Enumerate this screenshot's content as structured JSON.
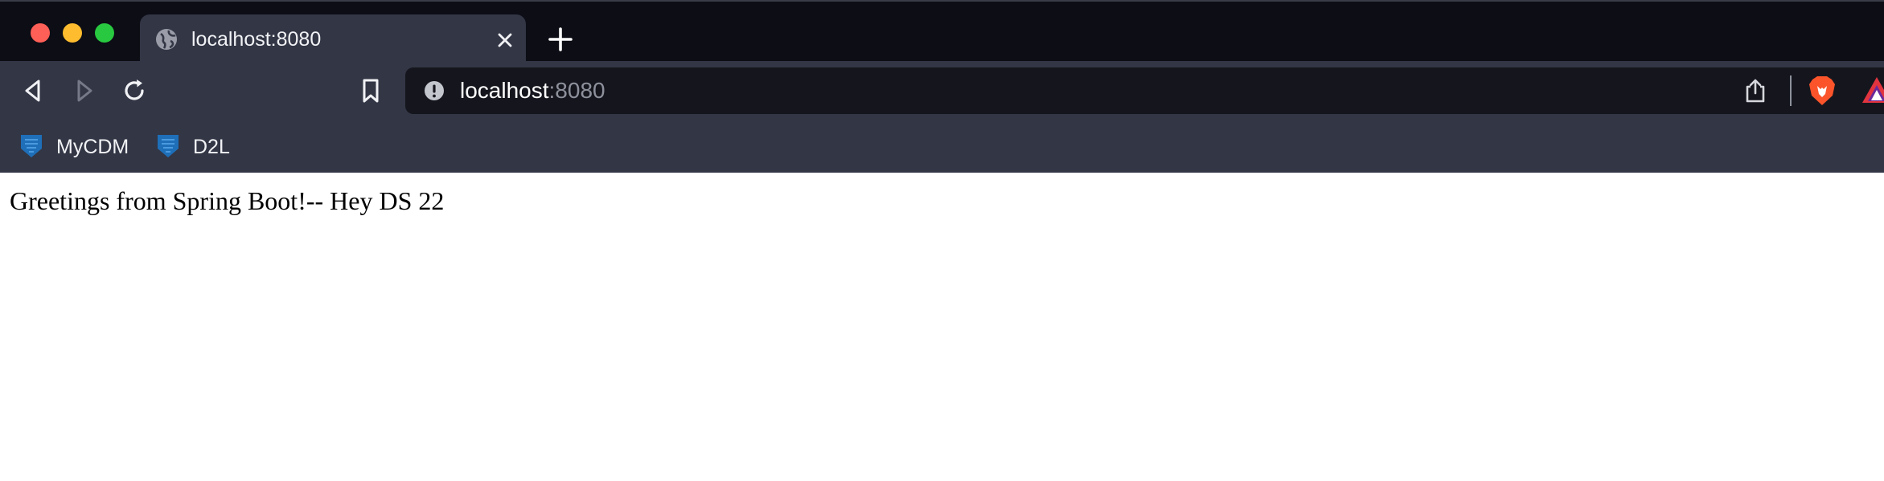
{
  "window": {
    "traffic_lights": [
      "close",
      "minimize",
      "zoom"
    ]
  },
  "tab": {
    "title": "localhost:8080",
    "icon": "globe-icon",
    "close_icon": "close-icon"
  },
  "toolbar": {
    "back_icon": "back-icon",
    "forward_icon": "forward-icon",
    "reload_icon": "reload-icon",
    "bookmark_icon": "bookmark-icon"
  },
  "address_bar": {
    "host": "localhost",
    "port": ":8080",
    "site_info_icon": "info-icon",
    "share_icon": "share-icon",
    "brave_shields_icon": "brave-lion-icon",
    "rewards_icon": "brave-rewards-icon"
  },
  "bookmarks": [
    {
      "label": "MyCDM",
      "icon": "shield-bookmark-icon"
    },
    {
      "label": "D2L",
      "icon": "shield-bookmark-icon"
    }
  ],
  "page": {
    "text": "Greetings from Spring Boot!-- Hey DS 22"
  },
  "colors": {
    "titlebar": "#0c0d15",
    "toolbar": "#333645",
    "urlbar": "#15161d",
    "port_text": "#8e919c",
    "bookmark_icon": "#1e6fb8"
  }
}
